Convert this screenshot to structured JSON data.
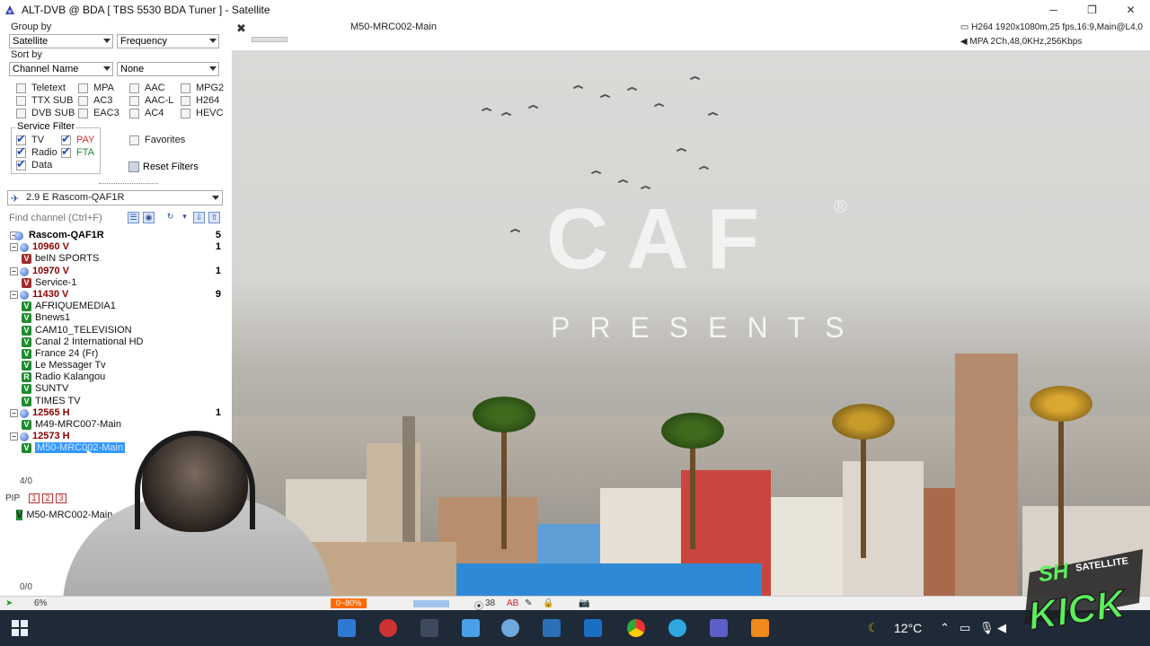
{
  "window": {
    "title": "ALT-DVB @ BDA [ TBS 5530 BDA Tuner ] - Satellite",
    "minimize": "─",
    "restore": "❐",
    "close": "✕"
  },
  "filters": {
    "group_by_label": "Group by",
    "group_by_value": "Satellite",
    "group_by_value2": "Frequency",
    "sort_by_label": "Sort by",
    "sort_by_value": "Channel Name",
    "sort_by_value2": "None",
    "stream_checks": [
      {
        "label": "Teletext",
        "checked": false
      },
      {
        "label": "MPA",
        "checked": false
      },
      {
        "label": "AAC",
        "checked": false
      },
      {
        "label": "MPG2",
        "checked": false
      },
      {
        "label": "TTX SUB",
        "checked": false
      },
      {
        "label": "AC3",
        "checked": false
      },
      {
        "label": "AAC-L",
        "checked": false
      },
      {
        "label": "H264",
        "checked": false
      },
      {
        "label": "DVB SUB",
        "checked": false
      },
      {
        "label": "EAC3",
        "checked": false
      },
      {
        "label": "AC4",
        "checked": false
      },
      {
        "label": "HEVC",
        "checked": false
      }
    ],
    "service_filter_label": "Service Filter",
    "tv": "TV",
    "pay": "PAY",
    "radio": "Radio",
    "fta": "FTA",
    "data": "Data",
    "favorites": "Favorites",
    "reset_filters": "Reset Filters"
  },
  "satellite": {
    "selected": "2.9 E Rascom-QAF1R",
    "search_placeholder": "Find channel (Ctrl+F)"
  },
  "tree": {
    "satellite_name": "Rascom-QAF1R",
    "satellite_count": "5",
    "tp1": "10960 V",
    "tp1_count": "1",
    "tp1_ch1": "beIN SPORTS",
    "tp2": "10970 V",
    "tp2_count": "1",
    "tp2_ch1": "Service-1",
    "tp3": "11430 V",
    "tp3_count": "9",
    "tp3_ch1": "AFRIQUEMEDIA1",
    "tp3_ch2": "Bnews1",
    "tp3_ch3": "CAM10_TELEVISION",
    "tp3_ch4": "Canal 2 International HD",
    "tp3_ch5": "France 24 (Fr)",
    "tp3_ch6": "Le Messager Tv",
    "tp3_ch7": "Radio Kalangou",
    "tp3_ch8": "SUNTV",
    "tp3_ch9": "TIMES TV",
    "tp4": "12565 H",
    "tp4_count": "1",
    "tp4_ch1": "M49-MRC007-Main",
    "tp5": "12573 H",
    "tp5_ch1": "M50-MRC002-Main"
  },
  "list_counter": "4/0",
  "pip": {
    "label": "PIP",
    "b1": "1",
    "b2": "2",
    "b3": "3",
    "item": "M50-MRC002-Main",
    "counter": "0/0"
  },
  "video": {
    "channel_name": "M50-MRC002-Main",
    "video_info": "H264 1920x1080m,25 fps,16:9,Main@L4,0",
    "audio_info": "MPA 2Ch,48,0KHz,256Kbps",
    "logo_text": "CAF",
    "logo_reg": "®",
    "presents": "PRESENTS"
  },
  "statusbar": {
    "cpu": "6%",
    "signal": "0~80%",
    "count": "38"
  },
  "taskbar": {
    "temperature": "12°C"
  },
  "watermark": {
    "line1": "SH SATELLITE",
    "line2": "KICK"
  },
  "colors": {
    "transponder": "#8b0000",
    "selection": "#3399ff",
    "taskbar": "#1f2a38",
    "accent_green": "#1f8a2e"
  }
}
